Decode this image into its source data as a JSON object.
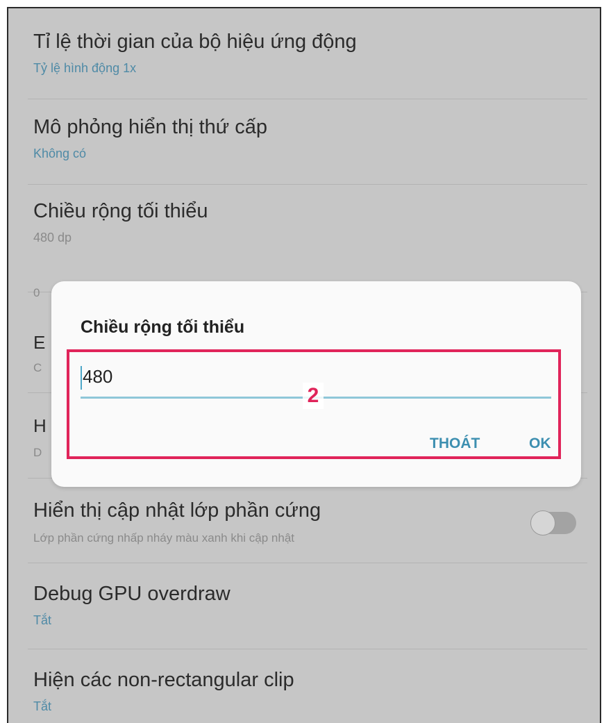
{
  "settings": [
    {
      "title": "Tỉ lệ thời gian của bộ hiệu ứng động",
      "subtitle": "Tỷ lệ hình động 1x"
    },
    {
      "title": "Mô phỏng hiển thị thứ cấp",
      "subtitle": "Không có"
    },
    {
      "title": "Chiều rộng tối thiểu",
      "subtitle": "480 dp"
    },
    {
      "title": "Hiển thị cập nhật lớp phần cứng",
      "subtitle": "Lớp phần cứng nhấp nháy màu xanh khi cập nhật"
    },
    {
      "title": "Debug GPU overdraw",
      "subtitle": "Tắt"
    },
    {
      "title": "Hiện các non-rectangular clip",
      "subtitle": "Tắt"
    }
  ],
  "partial_rows": {
    "row_a_initial": "0",
    "row_b_initial": "E",
    "row_b_sub_initial": "C",
    "row_c_initial": "H",
    "row_c_sub_initial": "D"
  },
  "dialog": {
    "title": "Chiều rộng tối thiểu",
    "input_value": "480",
    "annotation_number": "2",
    "cancel_label": "THOÁT",
    "ok_label": "OK"
  },
  "colors": {
    "background": "#c6c6c6",
    "subtitle_blue": "#4e8aa6",
    "accent": "#3d8fb0",
    "highlight": "#e0245a"
  },
  "icons": {
    "toggle": "toggle-off-icon"
  }
}
